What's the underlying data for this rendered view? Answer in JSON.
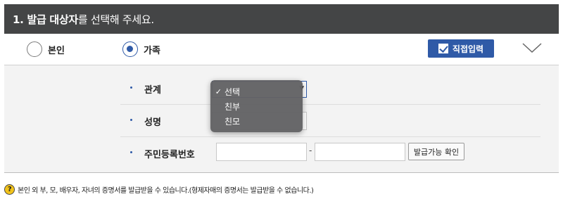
{
  "header": {
    "title_strong": "1. 발급 대상자",
    "title_normal": "를 선택해 주세요."
  },
  "choices": {
    "self_label": "본인",
    "family_label": "가족",
    "selected": "가족"
  },
  "direct_input_label": "직접입력",
  "icons": {
    "checkbox": "checkbox-checked-icon",
    "collapse": "chevron-down-icon",
    "help": "question-icon"
  },
  "colors": {
    "header_bg": "#444546",
    "accent": "#2f5aa7",
    "form_bg": "#f3f3f3"
  },
  "form": {
    "relation_label": "관계",
    "relation_value": "선택",
    "name_label": "성명",
    "name_value": "",
    "rrn_label": "주민등록번호",
    "rrn_front": "",
    "rrn_back": "",
    "rrn_separator": "-",
    "check_button": "발급가능 확인"
  },
  "dropdown": {
    "options": [
      "선택",
      "친부",
      "친모"
    ],
    "selected_index": 0,
    "check_mark": "✓"
  },
  "notice": {
    "icon_text": "?",
    "text": "본인 외 부, 모, 배우자, 자녀의 증명서를 발급받을 수 있습니다.(형제자매의 증명서는 발급받을 수 없습니다.)"
  }
}
